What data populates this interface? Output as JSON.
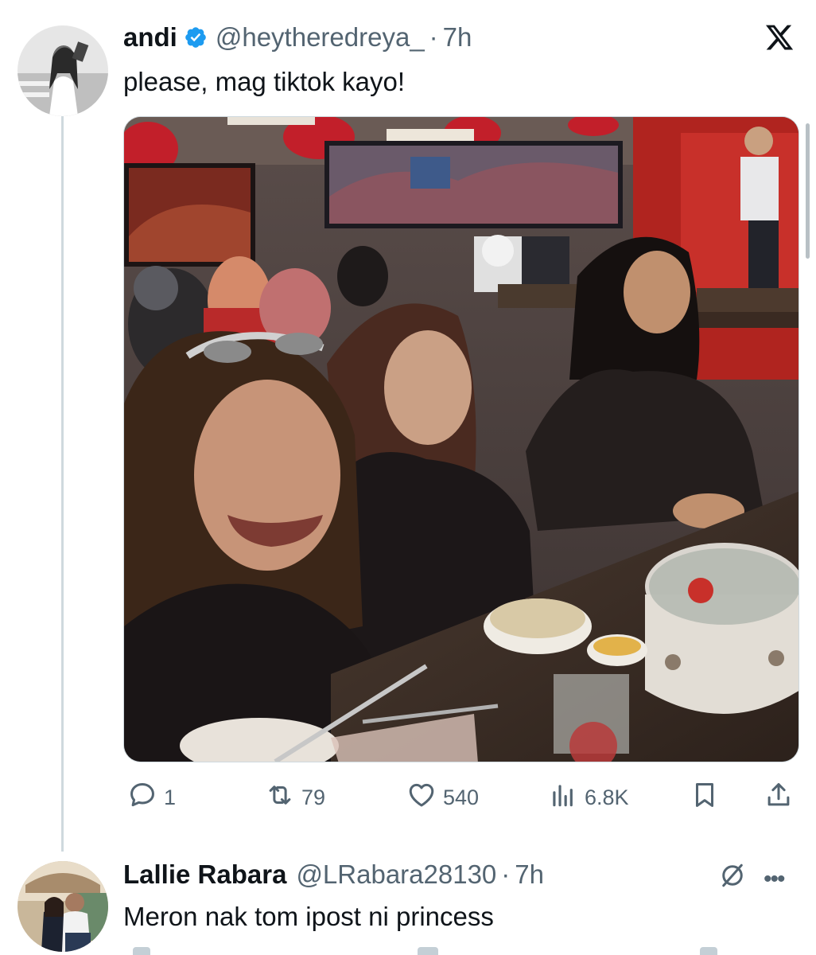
{
  "post": {
    "author_name": "andi",
    "handle": "@heytheredreya_",
    "separator": "·",
    "time": "7h",
    "text": "please, mag tiktok kayo!",
    "verified": true,
    "stats": {
      "replies": "1",
      "reposts": "79",
      "likes": "540",
      "views": "6.8K"
    }
  },
  "reply": {
    "author_name": "Lallie Rabara",
    "handle": "@LRabara28130",
    "separator": "·",
    "time": "7h",
    "text": "Meron nak tom ipost ni princess",
    "more_label": "•••"
  },
  "icons": {
    "logo": "x-logo-icon",
    "verified": "verified-badge-icon",
    "reply": "reply-icon",
    "repost": "repost-icon",
    "like": "heart-icon",
    "views": "views-chart-icon",
    "bookmark": "bookmark-icon",
    "share": "share-icon",
    "mute": "mute-icon"
  },
  "colors": {
    "text": "#0f1419",
    "secondary": "#536471",
    "verified_blue": "#1d9bf0",
    "divider": "#cfd9de"
  }
}
